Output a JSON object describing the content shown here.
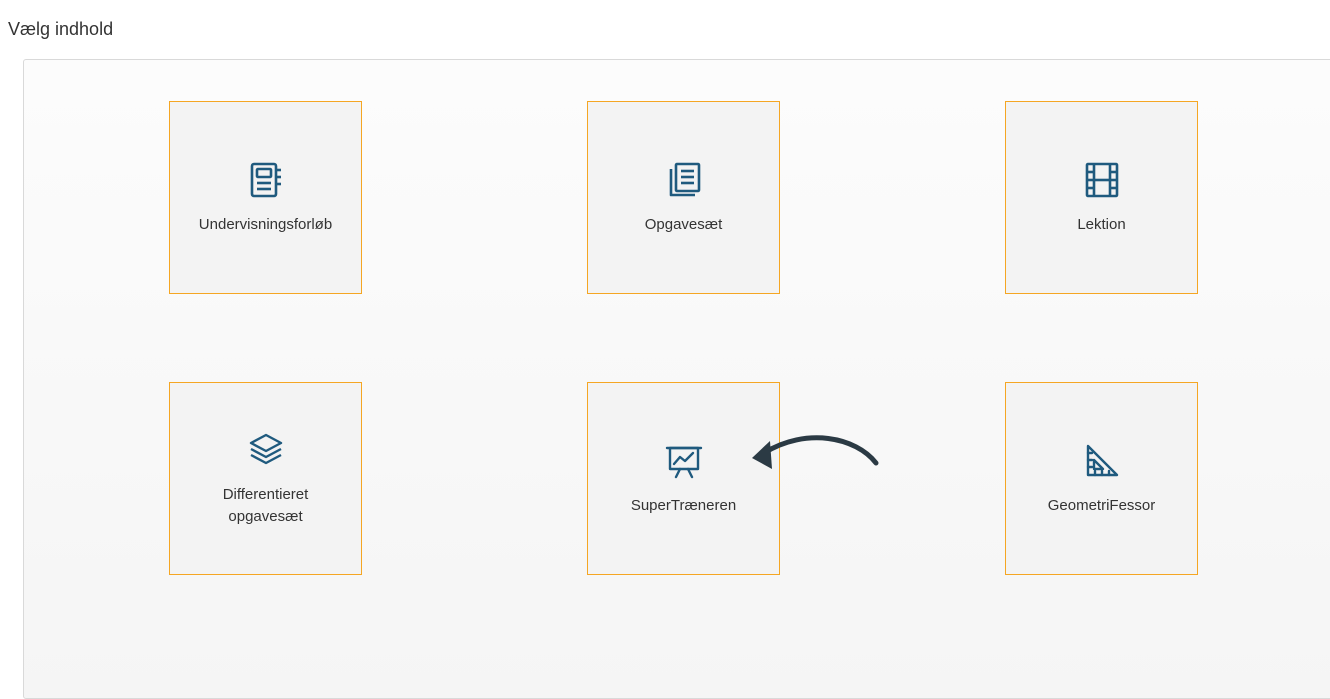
{
  "heading": "Vælg indhold",
  "accent_color": "#f5a623",
  "icon_color": "#1f5a7e",
  "tiles": [
    {
      "label": "Undervisningsforløb",
      "icon": "notebook-icon"
    },
    {
      "label": "Opgavesæt",
      "icon": "document-stack-icon"
    },
    {
      "label": "Lektion",
      "icon": "film-icon"
    },
    {
      "label": "Differentieret opgavesæt",
      "icon": "layers-icon"
    },
    {
      "label": "SuperTræneren",
      "icon": "presentation-chart-icon"
    },
    {
      "label": "GeometriFessor",
      "icon": "ruler-triangle-icon"
    }
  ]
}
